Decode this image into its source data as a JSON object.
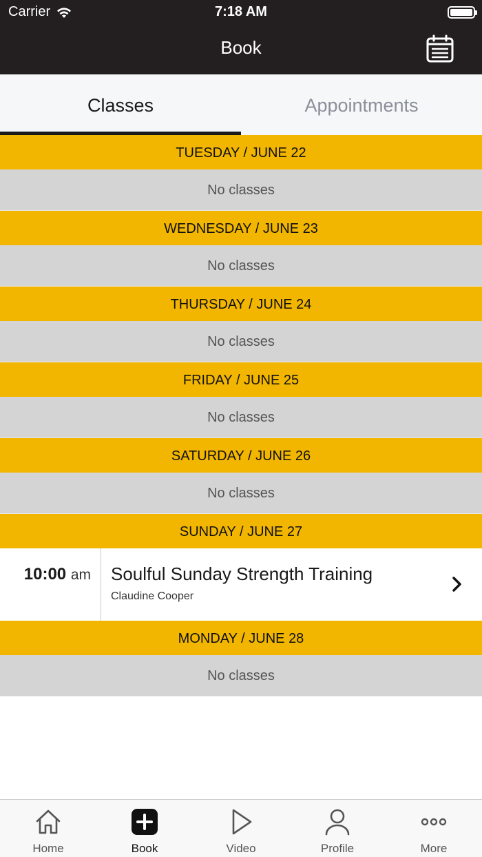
{
  "status_bar": {
    "carrier": "Carrier",
    "time": "7:18 AM"
  },
  "header": {
    "title": "Book",
    "calendar_icon": "calendar-icon"
  },
  "tabs": [
    {
      "label": "Classes",
      "active": true
    },
    {
      "label": "Appointments",
      "active": false
    }
  ],
  "schedule": {
    "days": [
      {
        "header": "TUESDAY / JUNE 22",
        "empty_text": "No classes"
      },
      {
        "header": "WEDNESDAY / JUNE 23",
        "empty_text": "No classes"
      },
      {
        "header": "THURSDAY / JUNE 24",
        "empty_text": "No classes"
      },
      {
        "header": "FRIDAY / JUNE 25",
        "empty_text": "No classes"
      },
      {
        "header": "SATURDAY / JUNE 26",
        "empty_text": "No classes"
      },
      {
        "header": "SUNDAY / JUNE 27",
        "classes": [
          {
            "time": "10:00",
            "ampm": "am",
            "name": "Soulful Sunday Strength Training",
            "instructor": "Claudine Cooper"
          }
        ]
      },
      {
        "header": "MONDAY / JUNE 28",
        "empty_text": "No classes"
      }
    ]
  },
  "tabbar": {
    "items": [
      {
        "label": "Home",
        "icon": "home-icon",
        "active": false
      },
      {
        "label": "Book",
        "icon": "plus-icon",
        "active": true
      },
      {
        "label": "Video",
        "icon": "play-icon",
        "active": false
      },
      {
        "label": "Profile",
        "icon": "person-icon",
        "active": false
      },
      {
        "label": "More",
        "icon": "more-icon",
        "active": false
      }
    ]
  },
  "colors": {
    "accent": "#f2b600",
    "topbar": "#231f20",
    "empty_row": "#d4d4d4"
  }
}
